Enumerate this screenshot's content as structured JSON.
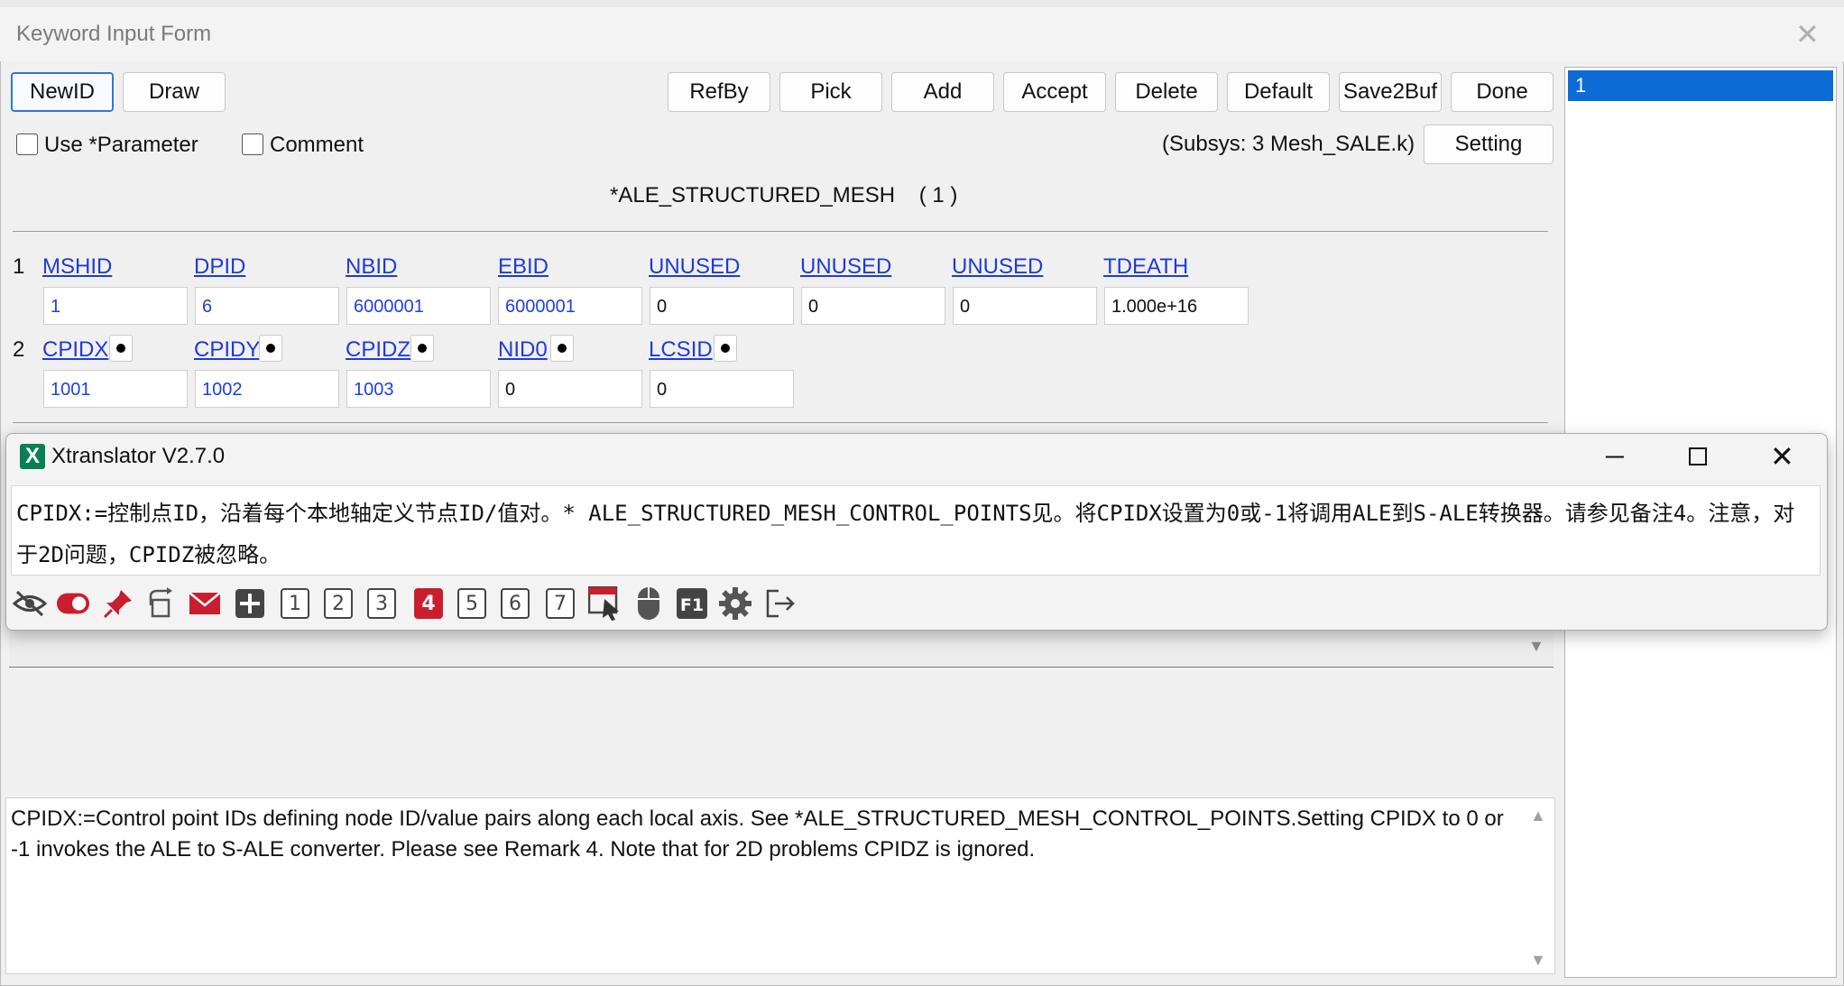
{
  "keyword_form": {
    "title": "Keyword Input Form",
    "toolbar_left": [
      "NewID",
      "Draw"
    ],
    "toolbar_right": [
      "RefBy",
      "Pick",
      "Add",
      "Accept",
      "Delete",
      "Default",
      "Save2Buf",
      "Done"
    ],
    "use_parameter_label": "Use *Parameter",
    "comment_label": "Comment",
    "subsys_text": "(Subsys: 3 Mesh_SALE.k)",
    "setting_label": "Setting",
    "keyword_heading": "*ALE_STRUCTURED_MESH    ( 1 )",
    "rows": [
      {
        "num": "1",
        "fields": [
          {
            "label": "MSHID",
            "value": "1",
            "color": "blue"
          },
          {
            "label": "DPID",
            "value": "6",
            "color": "blue"
          },
          {
            "label": "NBID",
            "value": "6000001",
            "color": "blue"
          },
          {
            "label": "EBID",
            "value": "6000001",
            "color": "blue"
          },
          {
            "label": "UNUSED",
            "value": "0",
            "color": "black"
          },
          {
            "label": "UNUSED",
            "value": "0",
            "color": "black"
          },
          {
            "label": "UNUSED",
            "value": "0",
            "color": "black"
          },
          {
            "label": "TDEATH",
            "value": "1.000e+16",
            "color": "black"
          }
        ]
      },
      {
        "num": "2",
        "fields": [
          {
            "label": "CPIDX",
            "value": "1001",
            "color": "blue"
          },
          {
            "label": "CPIDY",
            "value": "1002",
            "color": "blue"
          },
          {
            "label": "CPIDZ",
            "value": "1003",
            "color": "blue"
          },
          {
            "label": "NID0",
            "value": "0",
            "color": "black"
          },
          {
            "label": "LCSID",
            "value": "0",
            "color": "black"
          }
        ]
      }
    ],
    "id_list": [
      "1"
    ],
    "description": "CPIDX:=Control point IDs defining node ID/value pairs along each local axis. See *ALE_STRUCTURED_MESH_CONTROL_POINTS.Setting CPIDX to 0 or -1 invokes the ALE to S-ALE converter. Please see Remark 4. Note that for 2D problems CPIDZ is ignored."
  },
  "xtranslator": {
    "title": "Xtranslator V2.7.0",
    "logo": "X",
    "text": "CPIDX:=控制点ID，沿着每个本地轴定义节点ID/值对。* ALE_STRUCTURED_MESH_CONTROL_POINTS见。将CPIDX设置为0或-1将调用ALE到S-ALE转换器。请参见备注4。注意，对于2D问题，CPIDZ被忽略。",
    "number_buttons": [
      "1",
      "2",
      "3",
      "4",
      "5",
      "6",
      "7"
    ],
    "active_number": "4",
    "toolbar_icons": [
      "eye-off-icon",
      "toggle-icon",
      "pin-icon",
      "refresh-icon",
      "mail-icon",
      "plus-icon",
      "number-1",
      "number-2",
      "number-3",
      "number-4",
      "number-5",
      "number-6",
      "number-7",
      "select-cursor-icon",
      "mouse-icon",
      "f1-icon",
      "gear-icon",
      "exit-icon"
    ],
    "accent_red": "#c81e2e"
  }
}
